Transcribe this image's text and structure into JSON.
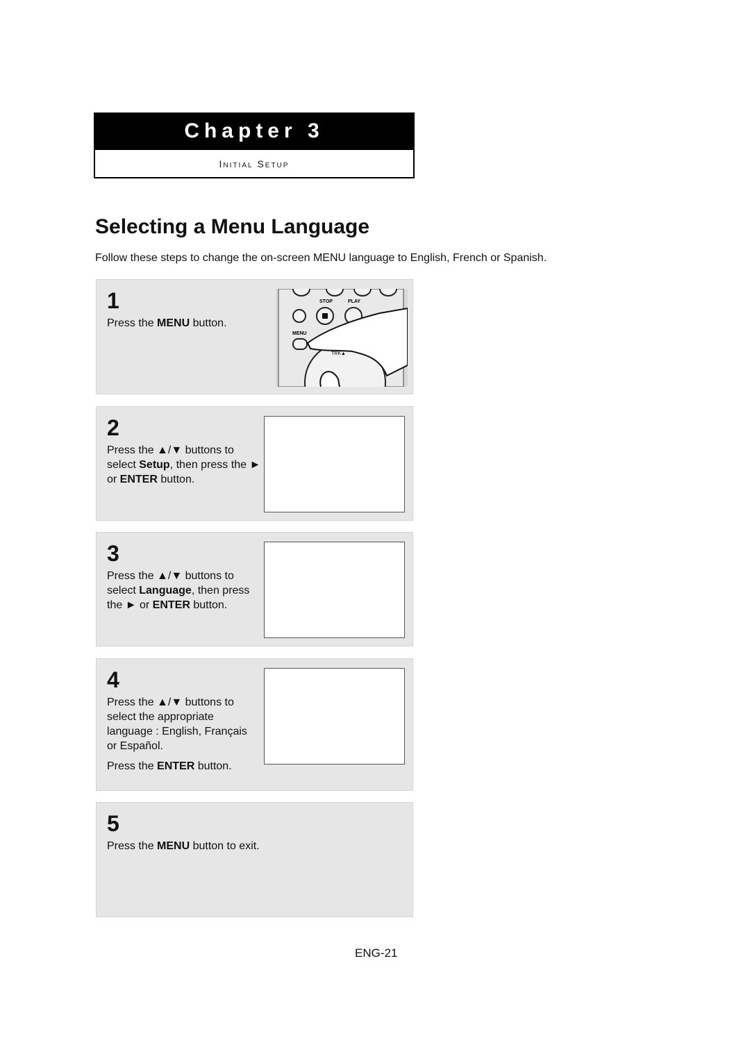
{
  "chapter": {
    "title": "Chapter 3",
    "subtitle": "Initial Setup"
  },
  "heading": "Selecting a Menu Language",
  "intro": "Follow these steps to change the on-screen MENU language to English, French or Spanish.",
  "steps": [
    {
      "number": "1",
      "lines": [
        [
          "Press the ",
          "MENU",
          " button."
        ]
      ]
    },
    {
      "number": "2",
      "l1": "Press the ▲/▼ buttons to",
      "l2a": "select ",
      "l2b": "Setup",
      ", then press the ►": "",
      "l2c": ", then press the ►",
      "l3a": "or ",
      "l3b": "ENTER",
      "l3c": " button."
    },
    {
      "number": "3",
      "l1": "Press the ▲/▼ buttons to",
      "l2a": "select ",
      "l2b": "Language",
      "l2c": ", then press",
      "l3a": "the ► or ",
      "l3b": "ENTER",
      "l3c": " button."
    },
    {
      "number": "4",
      "l1": "Press the ▲/▼ buttons to",
      "l2": "select the appropriate",
      "l3": "language : English, Français",
      "l4": "or Español.",
      "l5a": "Press the ",
      "l5b": "ENTER",
      "l5c": " button."
    },
    {
      "number": "5",
      "l1a": "Press the ",
      "l1b": "MENU",
      "l1c": " button to exit."
    }
  ],
  "remote_labels": {
    "stop": "STOP",
    "play": "PLAY",
    "menu": "MENU",
    "trk": "TRK▲"
  },
  "page_number": "ENG-21"
}
